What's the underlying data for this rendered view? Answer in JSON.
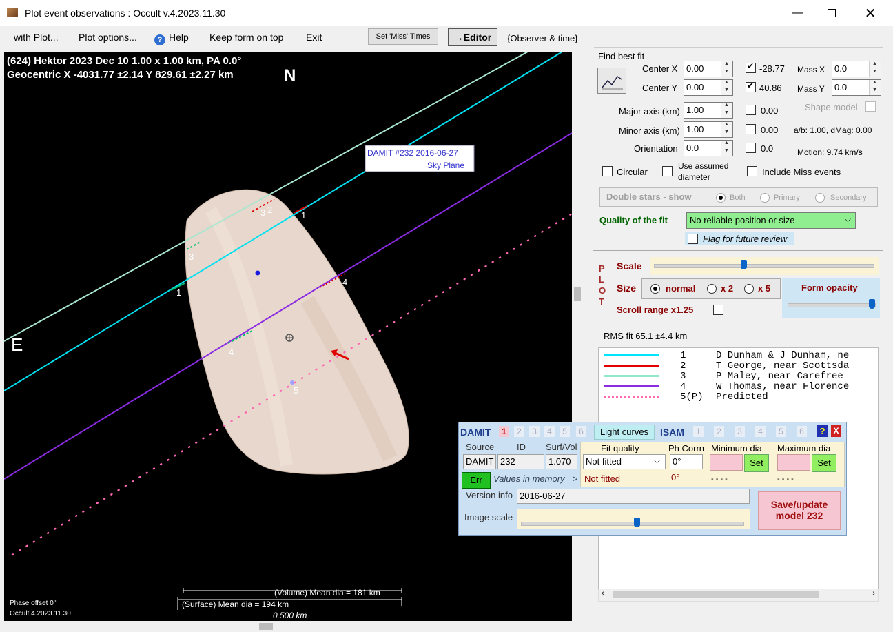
{
  "window": {
    "title": "Plot event observations : Occult v.4.2023.11.30",
    "minimize_icon": "minimize-icon",
    "maximize_icon": "maximize-icon",
    "close_icon": "close-icon"
  },
  "menu": {
    "with_plot": "with Plot...",
    "plot_options": "Plot options...",
    "help": "Help",
    "keep_form_on_top": "Keep form on top",
    "exit": "Exit",
    "set_miss_times": "Set 'Miss' Times",
    "editor": "→Editor",
    "observer_time": "{Observer & time}"
  },
  "plot": {
    "header_line1": "(624) Hektor  2023 Dec 10   1.00 x 1.00 km, PA 0.0°",
    "header_line2": "Geocentric  X  -4031.77 ±2.14  Y  829.61 ±2.27 km",
    "north": "N",
    "east": "E",
    "damit_label_line1": "DAMIT #232 2016-06-27",
    "damit_label_line2": "Sky Plane",
    "chord_labels": [
      "1",
      "2",
      "3",
      "4",
      "5",
      "1",
      "3",
      "4"
    ],
    "phase_offset": "Phase offset 0°",
    "version": "Occult 4.2023.11.30",
    "volume_mean": "(Volume) Mean dia = 181 km",
    "surface_mean": "(Surface) Mean dia = 194 km",
    "scale_bar": "0.500 km"
  },
  "fit": {
    "find_best_fit": "Find best fit",
    "center_x_label": "Center X",
    "center_x": "0.00",
    "center_y_label": "Center Y",
    "center_y": "0.00",
    "cx_value": "-28.77",
    "cy_value": "40.86",
    "mass_x_label": "Mass X",
    "mass_x": "0.0",
    "mass_y_label": "Mass Y",
    "mass_y": "0.0",
    "major_label": "Major axis (km)",
    "major": "1.00",
    "major_value": "0.00",
    "minor_label": "Minor axis (km)",
    "minor": "1.00",
    "minor_value": "0.00",
    "orient_label": "Orientation",
    "orient": "0.0",
    "orient_value": "0.0",
    "shape_model": "Shape model",
    "ab_dmag": "a/b: 1.00, dMag: 0.00",
    "motion": "Motion: 9.74 km/s",
    "circular": "Circular",
    "use_assumed_1": "Use assumed",
    "use_assumed_2": "diameter",
    "include_miss": "Include Miss events",
    "double_stars": "Double stars - show",
    "both": "Both",
    "primary": "Primary",
    "secondary": "Secondary",
    "quality_label": "Quality of the fit",
    "quality_value": "No reliable position or size",
    "flag_review": "Flag for future review"
  },
  "plotbox": {
    "plot_vertical": [
      "P",
      "L",
      "O",
      "T"
    ],
    "scale": "Scale",
    "size": "Size",
    "normal": "normal",
    "x2": "x 2",
    "x5": "x 5",
    "form_opacity": "Form opacity",
    "scroll_range": "Scroll range x1.25"
  },
  "rms": "RMS fit 65.1 ±4.4 km",
  "legend": [
    {
      "num": "1",
      "name": "D Dunham & J Dunham, ne",
      "color": "#00e5ff",
      "style": "solid"
    },
    {
      "num": "2",
      "name": "T George, near Scottsda",
      "color": "#e00000",
      "style": "solid"
    },
    {
      "num": "3",
      "name": "P Maley, near Carefree",
      "color": "#90e8c8",
      "style": "solid"
    },
    {
      "num": "4",
      "name": "W Thomas, near Florence",
      "color": "#8a2be2",
      "style": "solid"
    },
    {
      "num": "5(P)",
      "name": "Predicted",
      "color": "#ff69b4",
      "style": "dotted"
    }
  ],
  "damit": {
    "title": "DAMIT",
    "tabs": [
      "1",
      "2",
      "3",
      "4",
      "5",
      "6"
    ],
    "light_curves": "Light curves",
    "isam": "ISAM",
    "isam_tabs": [
      "1",
      "2",
      "3",
      "4",
      "5",
      "6"
    ],
    "help": "?",
    "close": "X",
    "source_label": "Source",
    "id_label": "ID",
    "surfvol_label": "Surf/Vol",
    "fit_quality_label": "Fit quality",
    "ph_corr_label": "Ph Corrn",
    "min_dia_label": "Minimum dia",
    "max_dia_label": "Maximum dia",
    "source": "DAMIT",
    "id": "232",
    "surfvol": "1.070",
    "fit_quality": "Not fitted",
    "ph_corr": "0°",
    "set": "Set",
    "err": "Err",
    "values_in_memory": "Values in memory =>",
    "mem_fit_quality": "Not fitted",
    "mem_ph": "0°",
    "dashes": "- - - -",
    "version_label": "Version info",
    "version": "2016-06-27",
    "image_scale": "Image scale",
    "save_line1": "Save/update",
    "save_line2": "model 232"
  }
}
